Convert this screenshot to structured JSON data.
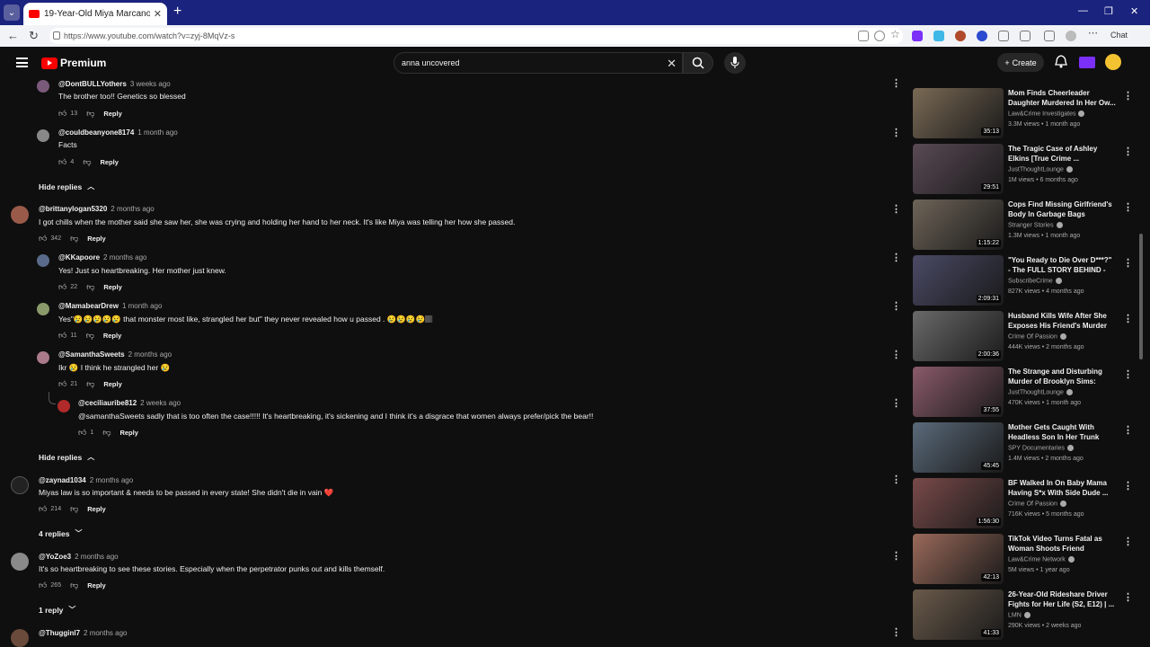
{
  "browser": {
    "tab_title": "19-Year-Old Miya Marcano's Disap",
    "url": "https://www.youtube.com/watch?v=zyj-8MqVz-s",
    "chat_label": "Chat"
  },
  "header": {
    "logo_text": "Premium",
    "search_value": "anna uncovered",
    "create_label": "Create"
  },
  "comments": [
    {
      "handle": "@DontBULLYothers",
      "time": "3 weeks ago",
      "text": "The brother too!! Genetics so blessed",
      "likes": "13",
      "reply": "Reply"
    },
    {
      "handle": "@couldbeanyone8174",
      "time": "1 month ago",
      "text": "Facts",
      "likes": "4",
      "reply": "Reply"
    },
    {
      "toggle": "Hide replies"
    },
    {
      "handle": "@brittanylogan5320",
      "time": "2 months ago",
      "text": "I got chills when the mother said she saw her, she was crying and holding her hand to her neck. It's like Miya was telling her how she passed.",
      "likes": "342",
      "reply": "Reply"
    },
    {
      "handle": "@KKapoore",
      "time": "2 months ago",
      "text": "Yes! Just so heartbreaking. Her mother just knew.",
      "likes": "22",
      "reply": "Reply"
    },
    {
      "handle": "@MamabearDrew",
      "time": "1 month ago",
      "text": "Yes\"😢😢😢😢😢 that monster most like, strangled her but\" they never revealed how u passed . 😢😢😢😢🏽",
      "likes": "11",
      "reply": "Reply"
    },
    {
      "handle": "@SamanthaSweets",
      "time": "2 months ago",
      "text": "Ikr 😢 I think he strangled her 😢",
      "likes": "21",
      "reply": "Reply"
    },
    {
      "handle": "@ceciliauribe812",
      "time": "2 weeks ago",
      "text": "@samanthaSweets sadly that is too often the case!!!!! It's heartbreaking, it's sickening and I think it's a disgrace that women always prefer/pick the bear!!",
      "likes": "1",
      "reply": "Reply"
    },
    {
      "toggle": "Hide replies"
    },
    {
      "handle": "@zaynad1034",
      "time": "2 months ago",
      "text": "Miyas law is so important & needs to be passed in every state! She didn't die in vain ❤️",
      "likes": "214",
      "reply": "Reply"
    },
    {
      "toggle": "4 replies"
    },
    {
      "handle": "@YoZoe3",
      "time": "2 months ago",
      "text": "It's so heartbreaking to see these stories. Especially when the perpetrator punks out and kills themself.",
      "likes": "265",
      "reply": "Reply"
    },
    {
      "toggle": "1 reply"
    },
    {
      "handle": "@Thugginl7",
      "time": "2 months ago",
      "text": ""
    }
  ],
  "sidebar": {
    "videos": [
      {
        "title": "Mom Finds Cheerleader Daughter Murdered In Her Ow...",
        "channel": "Law&Crime Investigates",
        "meta": "3.3M views • 1 month ago",
        "duration": "35:13",
        "color": "#7a6a55"
      },
      {
        "title": "The Tragic Case of Ashley Elkins [True Crime ...",
        "channel": "JustThoughtLounge",
        "meta": "1M views • 6 months ago",
        "duration": "29:51",
        "color": "#5a4a55"
      },
      {
        "title": "Cops Find Missing Girlfriend's Body In Garbage Bags",
        "channel": "Stranger Stories",
        "meta": "1.3M views • 1 month ago",
        "duration": "1:15:22",
        "color": "#6e6458"
      },
      {
        "title": "\"You Ready to Die Over D***?\" - The FULL STORY BEHIND - Th...",
        "channel": "SubscribeCrime",
        "meta": "827K views • 4 months ago",
        "duration": "2:09:31",
        "color": "#4a4a66"
      },
      {
        "title": "Husband Kills Wife After She Exposes His Friend's Murder O...",
        "channel": "Crime Of Passion",
        "meta": "444K views • 2 months ago",
        "duration": "2:00:36",
        "color": "#6a6a6a"
      },
      {
        "title": "The Strange and Disturbing Murder of Brooklyn Sims: True...",
        "channel": "JustThoughtLounge",
        "meta": "470K views • 1 month ago",
        "duration": "37:55",
        "color": "#8a5a6a"
      },
      {
        "title": "Mother Gets Caught With Headless Son In Her Trunk",
        "channel": "SPY Documentaries",
        "meta": "1.4M views • 2 months ago",
        "duration": "45:45",
        "color": "#5a6a7a"
      },
      {
        "title": "BF Walked In On Baby Mama Having S*x With Side Dude ...",
        "channel": "Crime Of Passion",
        "meta": "716K views • 5 months ago",
        "duration": "1:56:30",
        "color": "#7a4a4a"
      },
      {
        "title": "TikTok Video Turns Fatal as Woman Shoots Friend",
        "channel": "Law&Crime Network",
        "meta": "5M views • 1 year ago",
        "duration": "42:13",
        "color": "#9a6a5a"
      },
      {
        "title": "26-Year-Old Rideshare Driver Fights for Her Life (S2, E12) | ...",
        "channel": "LMN",
        "meta": "290K views • 2 weeks ago",
        "duration": "41:33",
        "color": "#6a5a4a"
      }
    ]
  }
}
